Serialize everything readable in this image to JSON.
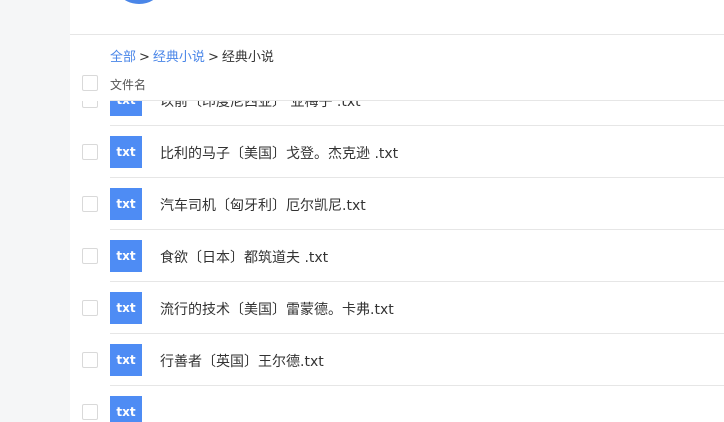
{
  "breadcrumb": {
    "root": "全部",
    "parent": "经典小说",
    "current": "经典小说",
    "separator": ">"
  },
  "table": {
    "column_filename": "文件名"
  },
  "files": [
    {
      "icon_label": "txt",
      "name": "以前〔印度尼西亚〕 亚梅子 .txt"
    },
    {
      "icon_label": "txt",
      "name": "比利的马子〔美国〕戈登。杰克逊 .txt"
    },
    {
      "icon_label": "txt",
      "name": "汽车司机〔匈牙利〕厄尔凯尼.txt"
    },
    {
      "icon_label": "txt",
      "name": "食欲〔日本〕都筑道夫 .txt"
    },
    {
      "icon_label": "txt",
      "name": "流行的技术〔美国〕雷蒙德。卡弗.txt"
    },
    {
      "icon_label": "txt",
      "name": "行善者〔英国〕王尔德.txt"
    },
    {
      "icon_label": "txt",
      "name": ""
    }
  ],
  "colors": {
    "accent": "#4a86e8",
    "file_icon_bg": "#4e8cf4"
  }
}
